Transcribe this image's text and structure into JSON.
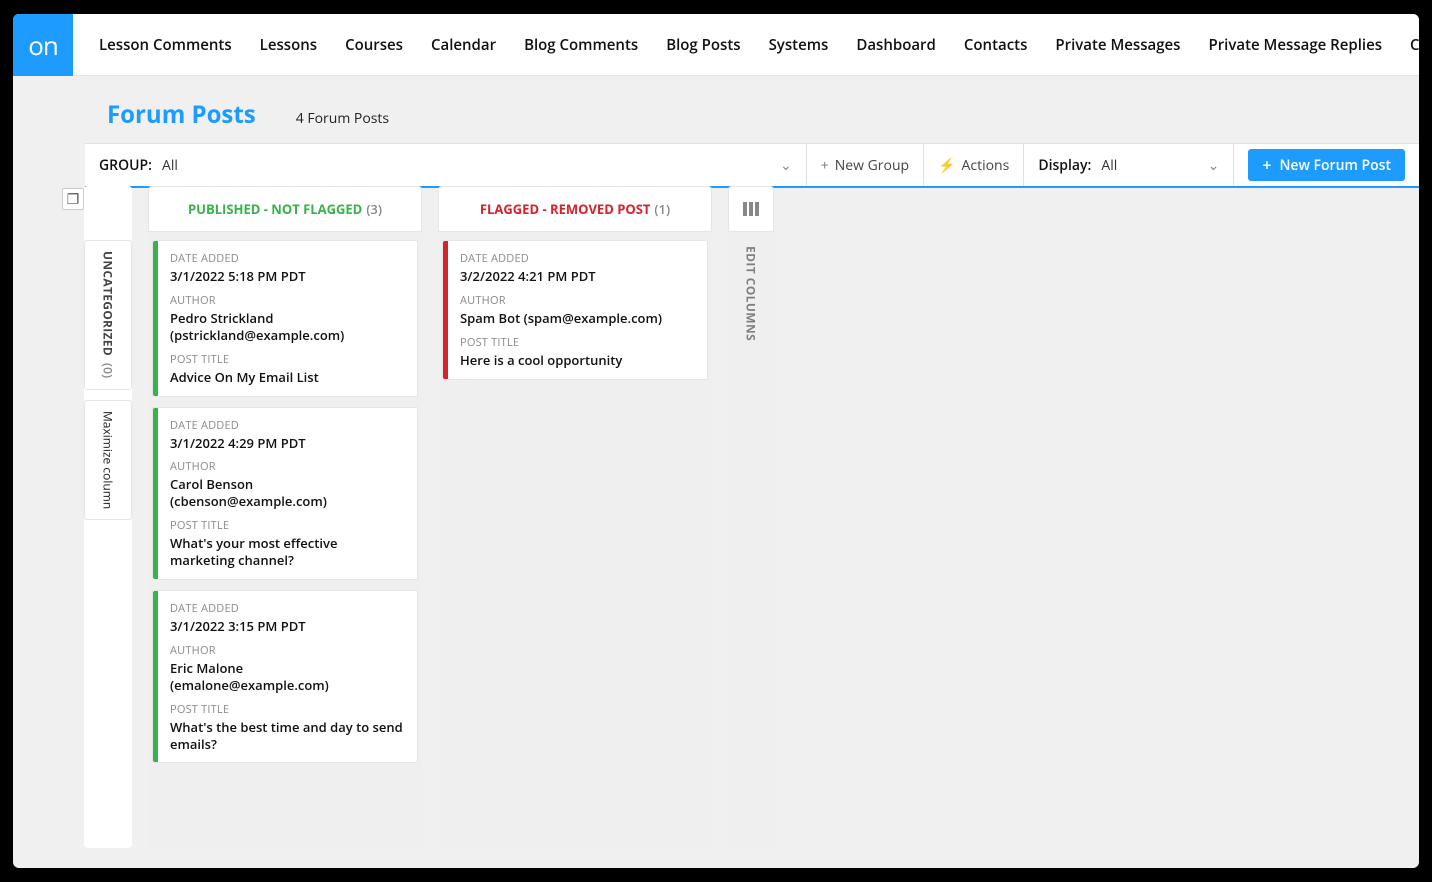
{
  "brand": {
    "logo": "on"
  },
  "topnav": {
    "items": [
      "Lesson Comments",
      "Lessons",
      "Courses",
      "Calendar",
      "Blog Comments",
      "Blog Posts",
      "Systems",
      "Dashboard",
      "Contacts",
      "Private Messages",
      "Private Message Replies",
      "Companies"
    ]
  },
  "page": {
    "title": "Forum Posts",
    "subtitle": "4 Forum Posts"
  },
  "toolbar": {
    "group_label": "GROUP:",
    "group_value": "All",
    "new_group_label": "New Group",
    "actions_label": "Actions",
    "display_label": "Display:",
    "display_value": "All",
    "new_btn": "New Forum Post"
  },
  "sidecol": {
    "uncategorized_label": "UNCATEGORIZED",
    "uncategorized_count": "(0)",
    "maximize_label": "Maximize column"
  },
  "editcols_label": "EDIT COLUMNS",
  "labels": {
    "date_added": "DATE ADDED",
    "author": "AUTHOR",
    "post_title": "POST TITLE"
  },
  "columns": [
    {
      "id": "published",
      "title": "PUBLISHED - NOT FLAGGED",
      "count": "(3)",
      "accent": "#37b34a",
      "stripe": "green",
      "cards": [
        {
          "date": "3/1/2022 5:18 PM PDT",
          "author": "Pedro Strickland (pstrickland@example.com)",
          "title": "Advice On My Email List"
        },
        {
          "date": "3/1/2022 4:29 PM PDT",
          "author": "Carol Benson (cbenson@example.com)",
          "title": "What's your most effective marketing channel?"
        },
        {
          "date": "3/1/2022 3:15 PM PDT",
          "author": "Eric Malone (emalone@example.com)",
          "title": "What's the best time and day to send emails?"
        }
      ]
    },
    {
      "id": "flagged",
      "title": "FLAGGED - REMOVED POST",
      "count": "(1)",
      "accent": "#d4232a",
      "stripe": "red",
      "cards": [
        {
          "date": "3/2/2022 4:21 PM PDT",
          "author": "Spam Bot (spam@example.com)",
          "title": "Here is a cool opportunity"
        }
      ]
    }
  ]
}
